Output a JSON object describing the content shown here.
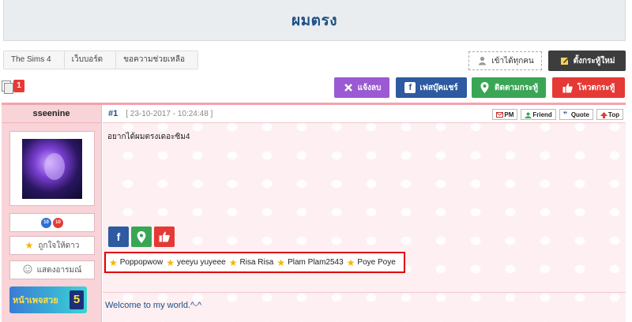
{
  "page": {
    "title": "ผมตรง"
  },
  "breadcrumb": {
    "items": [
      "The Sims 4",
      "เว็บบอร์ด",
      "ขอความช่วยเหลือ"
    ]
  },
  "actions": {
    "enter_label": "เข้าได้ทุกคน",
    "new_topic_label": "ตั้งกระทู้ใหม่",
    "report_label": "แจ้งลบ",
    "facebook_share_label": "เฟสบุ๊คแชร์",
    "follow_label": "ติดตามกระทู้",
    "vote_label": "โหวตกระทู้"
  },
  "pager": {
    "current_page": "1"
  },
  "post": {
    "author": "sseenine",
    "number": "#1",
    "timestamp": "[ 23-10-2017 - 10:24:48 ]",
    "message": "อยากได้ผมตรงเดอะซิม4",
    "signature": "Welcome to my world.^-^",
    "mini_buttons": [
      "PM",
      "Friend",
      "Quote",
      "Top"
    ],
    "badges": [
      "10",
      "10"
    ],
    "like_button_label": "ถูกใจให้ดาว",
    "emotion_button_label": "แสดงอารมณ์",
    "promo_text": "หน้าเพจสวย",
    "promo_number": "5",
    "likers": [
      "Poppopwow",
      "yeeyu yuyeee",
      "Risa Risa",
      "Plam Plam2543",
      "Poye Poye"
    ]
  },
  "colors": {
    "title": "#1d4f84",
    "report": "#9b59d3",
    "facebook": "#2d5aa0",
    "follow": "#3aa655",
    "vote": "#e53935",
    "sidebar": "#f8d3d8",
    "highlight": "#e00000"
  }
}
